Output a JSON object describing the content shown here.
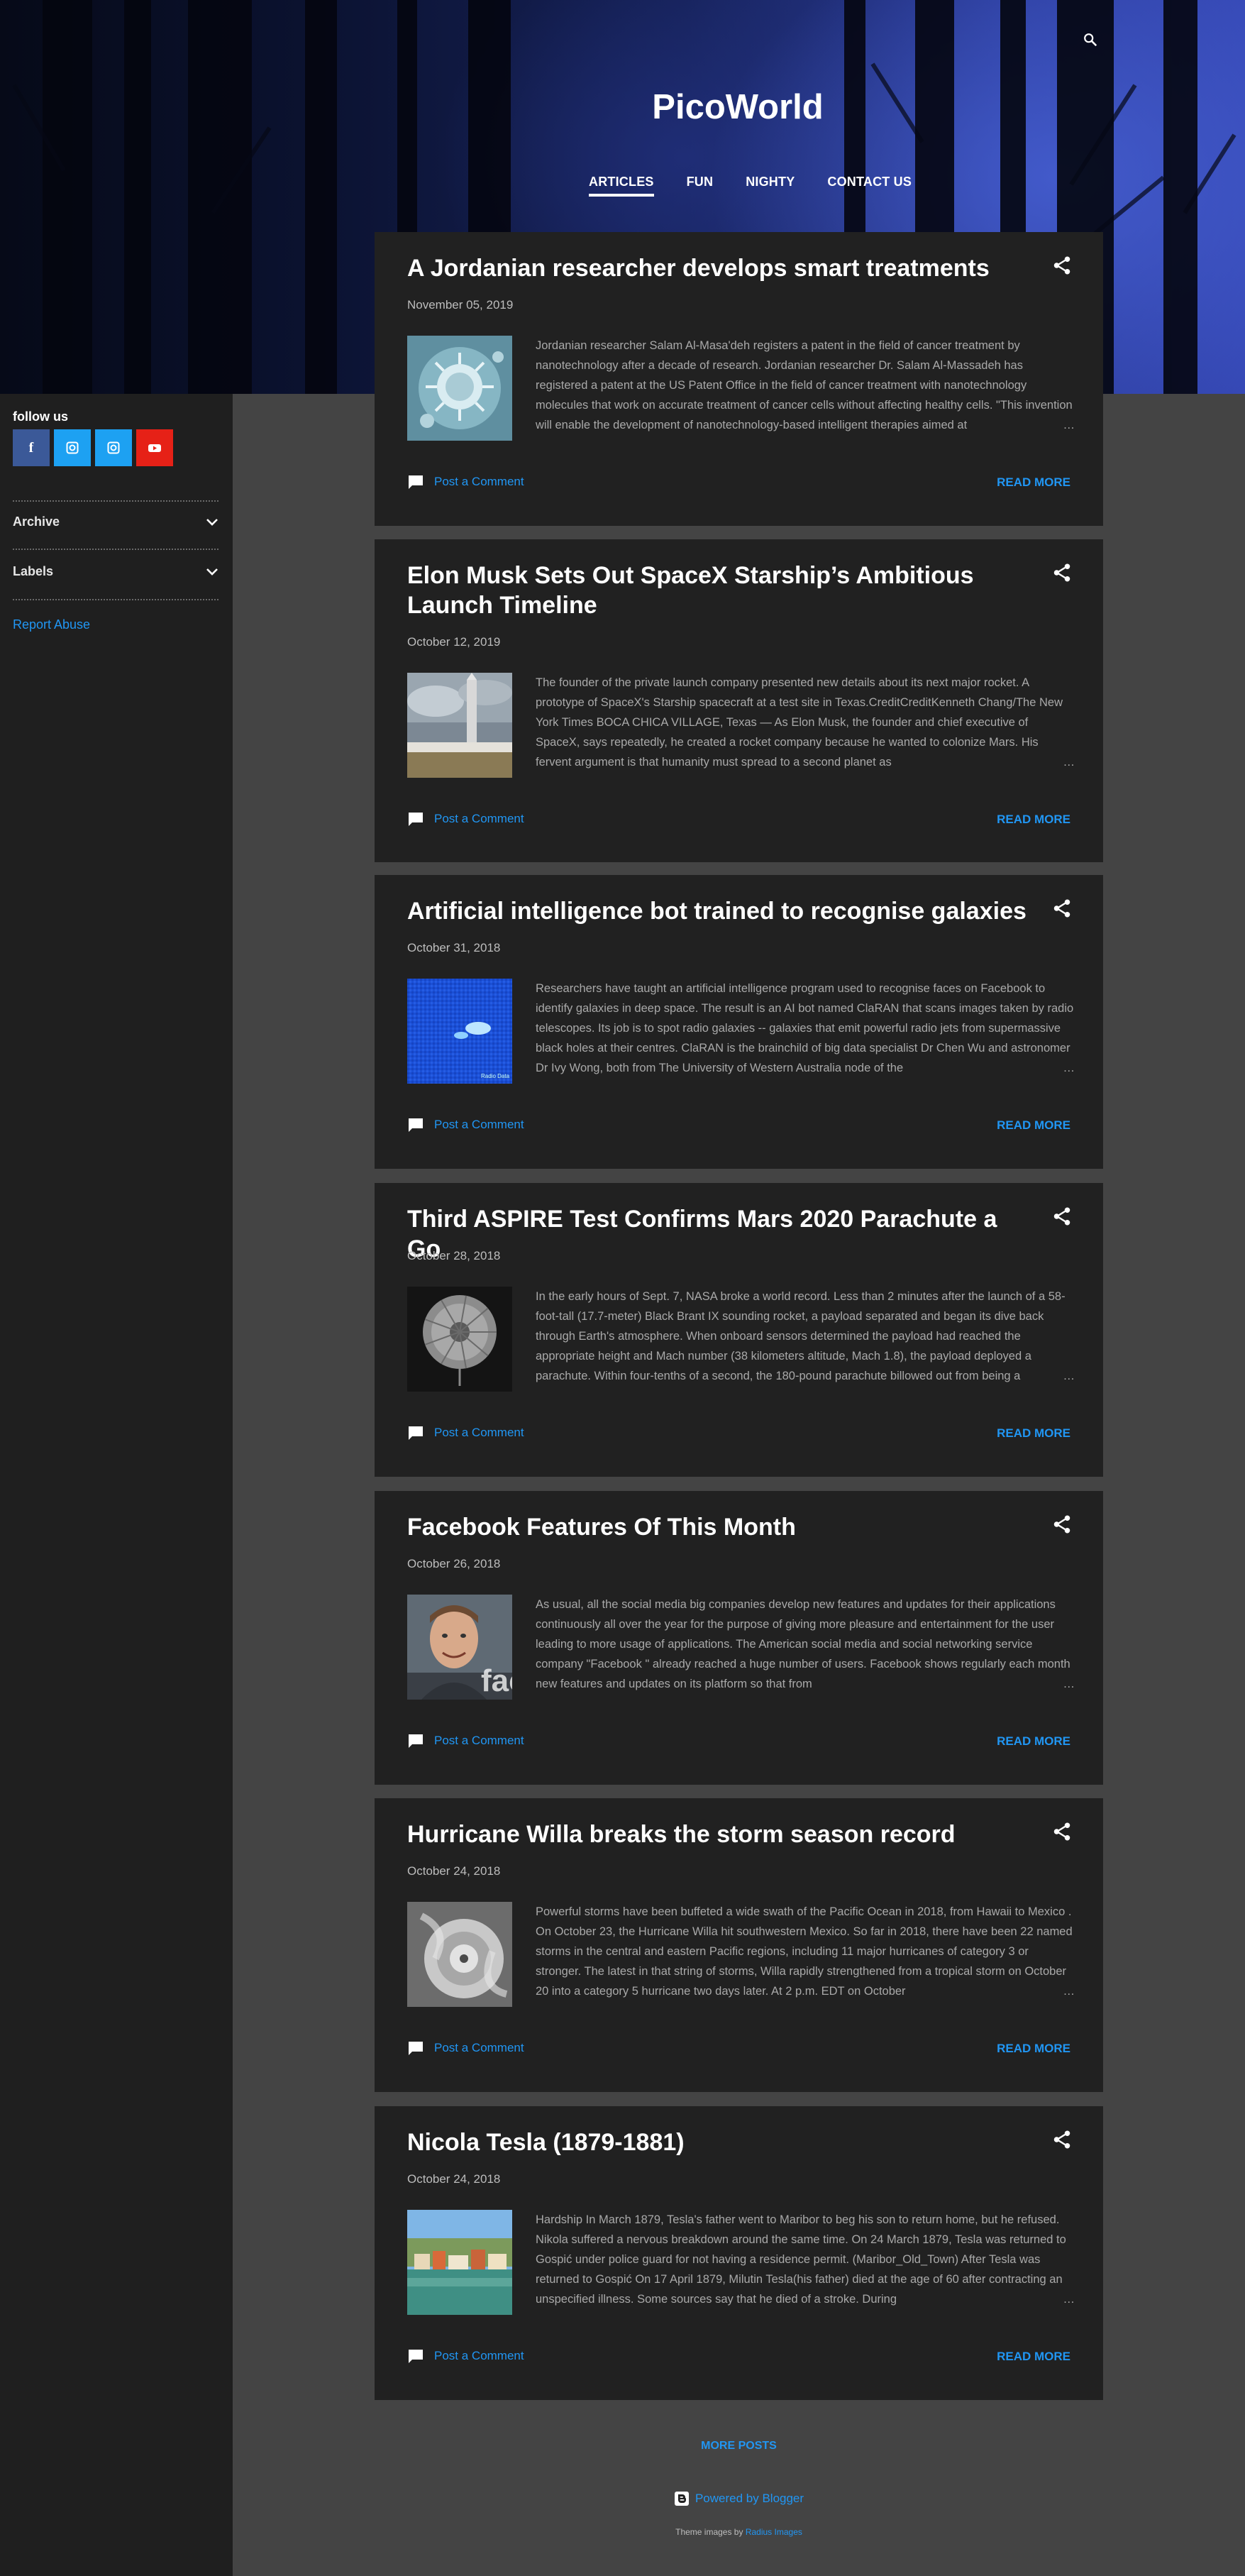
{
  "header": {
    "site_title": "PicoWorld",
    "nav": [
      "ARTICLES",
      "FUN",
      "NIGHTY",
      "CONTACT US"
    ],
    "active_nav": "ARTICLES"
  },
  "sidebar": {
    "follow_title": "follow us",
    "social": [
      {
        "name": "facebook",
        "glyph": "f",
        "color": "#3b5998"
      },
      {
        "name": "instagram",
        "glyph": "◙",
        "color": "#1da1f2"
      },
      {
        "name": "instagram",
        "glyph": "◙",
        "color": "#1da1f2"
      },
      {
        "name": "youtube",
        "glyph": "▶",
        "color": "#e62117"
      }
    ],
    "archive_label": "Archive",
    "labels_label": "Labels",
    "report_abuse": "Report Abuse"
  },
  "posts": [
    {
      "title": "A Jordanian researcher develops smart treatments",
      "date": "November 05, 2019",
      "snippet": "Jordanian researcher Salam Al-Masa'deh registers a patent in the field of cancer treatment by nanotechnology after a decade of research. Jordanian researcher Dr. Salam Al-Massadeh has registered a patent at the US Patent Office in the field of cancer treatment with nanotechnology molecules that work on accurate treatment of cancer cells without affecting healthy cells. \"This invention will enable the development of nanotechnology-based intelligent therapies aimed at",
      "thumb": "virus",
      "comment": "Post a Comment",
      "read_more": "READ MORE"
    },
    {
      "title": "Elon Musk Sets Out SpaceX Starship’s Ambitious Launch Timeline",
      "date": "October 12, 2019",
      "snippet": "The founder of the private launch company presented new details about its next major rocket. A prototype of SpaceX's Starship spacecraft at a test site in Texas.CreditCreditKenneth Chang/The New York Times BOCA CHICA VILLAGE, Texas — As Elon Musk, the founder and chief executive of SpaceX, says repeatedly, he created a rocket company because he wanted to colonize Mars. His fervent argument is that humanity must spread to a second planet as",
      "thumb": "starship",
      "comment": "Post a Comment",
      "read_more": "READ MORE"
    },
    {
      "title": "Artificial intelligence bot trained to recognise galaxies",
      "date": "October 31, 2018",
      "snippet": "Researchers have taught an artificial intelligence program used to recognise faces on Facebook to identify galaxies in deep space. The result is an AI bot named ClaRAN that scans images taken by radio telescopes. Its job is to spot radio galaxies -- galaxies that emit powerful radio jets from supermassive black holes at their centres. ClaRAN is the brainchild of big data specialist Dr Chen Wu and astronomer Dr Ivy Wong, both from The University of Western Australia node of the",
      "thumb": "galaxy",
      "comment": "Post a Comment",
      "read_more": "READ MORE"
    },
    {
      "title": "Third ASPIRE Test Confirms Mars 2020 Parachute a Go",
      "date": "October 28, 2018",
      "snippet": "In the early hours of Sept. 7, NASA broke a world record. Less than 2 minutes after the launch of a 58-foot-tall (17.7-meter) Black Brant IX sounding rocket, a payload separated and began its dive back through Earth's atmosphere. When onboard sensors determined the payload had reached the appropriate height and Mach number (38 kilometers altitude, Mach 1.8), the payload deployed a parachute. Within four-tenths of a second, the 180-pound parachute billowed out from being a",
      "thumb": "parachute",
      "comment": "Post a Comment",
      "read_more": "READ MORE"
    },
    {
      "title": "Facebook Features Of This Month",
      "date": "October 26, 2018",
      "snippet": "As usual, all the social media big companies develop new features and updates for their applications continuously all over the year for the purpose of giving more pleasure and entertainment for the user leading to more usage of applications. The American social media and social networking service company  \"Facebook \" already reached a huge number of users. Facebook shows regularly each month new features and updates on its platform so that from",
      "thumb": "person",
      "thumb_text": "fac",
      "comment": "Post a Comment",
      "read_more": "READ MORE"
    },
    {
      "title": "Hurricane Willa breaks the storm season record",
      "date": "October 24, 2018",
      "snippet": "Powerful storms have been buffeted a wide swath of the Pacific Ocean in 2018, from  Hawaii to Mexico . On October 23, the Hurricane Willa hit southwestern Mexico. So far in 2018, there have been 22 named storms in the central and eastern Pacific regions, including 11 major hurricanes of category 3 or stronger. The latest in that string of storms, Willa rapidly strengthened from a tropical storm on October 20 into a category 5 hurricane two days later. At 2 p.m. EDT on October",
      "thumb": "hurricane",
      "comment": "Post a Comment",
      "read_more": "READ MORE"
    },
    {
      "title": "Nicola Tesla (1879-1881)",
      "date": "October 24, 2018",
      "snippet": "Hardship In March 1879, Tesla's father went to  Maribor  to beg his son to return home, but he refused. Nikola suffered a nervous breakdown around the same time. On 24 March 1879, Tesla was returned to Gospić under police guard for not having a residence permit. (Maribor_Old_Town)          After Tesla was returned to  Gospić On 17 April 1879, Milutin Tesla(his father) died at the age of 60 after contracting an unspecified illness. Some sources say that he died of a stroke. During",
      "thumb": "town",
      "comment": "Post a Comment",
      "read_more": "READ MORE"
    }
  ],
  "footer": {
    "more_posts": "MORE POSTS",
    "powered_by": "Powered by Blogger",
    "theme_prefix": "Theme images by",
    "theme_link": "Radius Images"
  },
  "colors": {
    "accent": "#2196f3",
    "card": "#212121",
    "sidebar": "#1f1f1f",
    "page": "#444444"
  }
}
